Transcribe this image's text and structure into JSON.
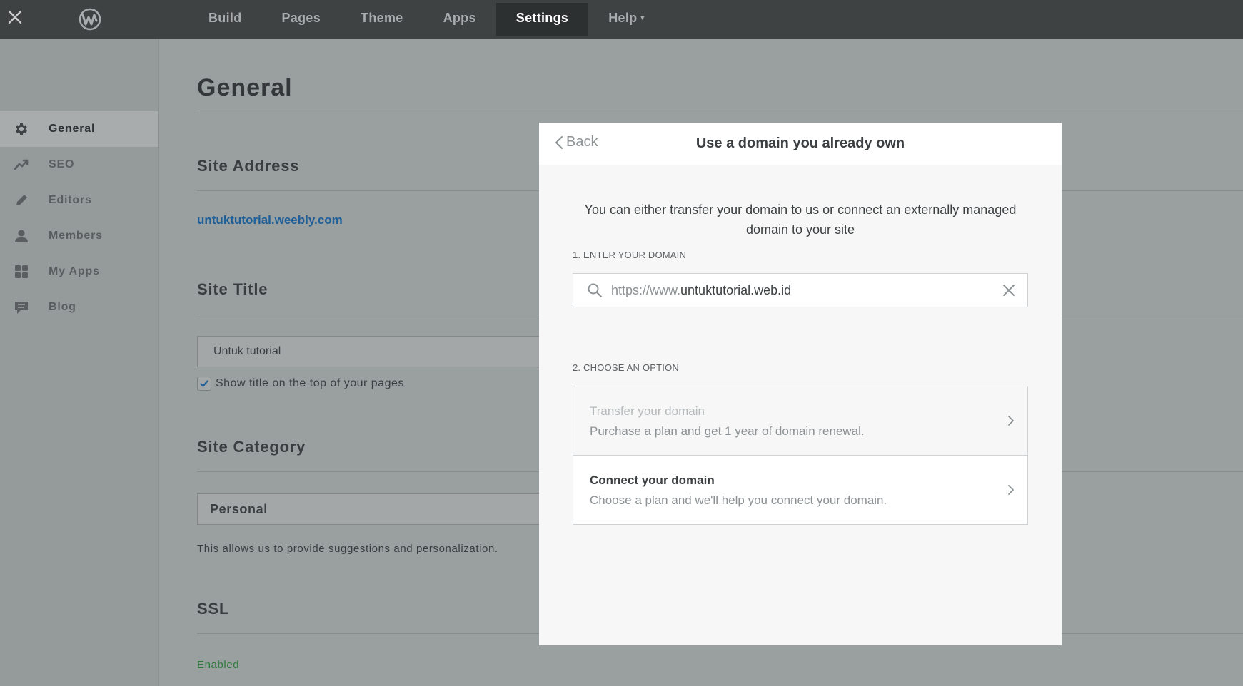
{
  "topbar": {
    "close_icon": "x-icon",
    "logo": "weebly-logo",
    "nav": [
      {
        "label": "Build"
      },
      {
        "label": "Pages"
      },
      {
        "label": "Theme"
      },
      {
        "label": "Apps"
      },
      {
        "label": "Settings"
      },
      {
        "label": "Help"
      }
    ],
    "active_nav": "Settings"
  },
  "sidebar": {
    "items": [
      {
        "label": "General",
        "icon": "gear-icon"
      },
      {
        "label": "SEO",
        "icon": "trend-icon"
      },
      {
        "label": "Editors",
        "icon": "pencil-icon"
      },
      {
        "label": "Members",
        "icon": "person-icon"
      },
      {
        "label": "My Apps",
        "icon": "grid-icon"
      },
      {
        "label": "Blog",
        "icon": "comment-icon"
      }
    ],
    "active": "General"
  },
  "main": {
    "title": "General",
    "site_address": {
      "heading": "Site Address",
      "url": "untuktutorial.weebly.com"
    },
    "site_title": {
      "heading": "Site Title",
      "value": "Untuk tutorial",
      "checkbox_label": "Show title on the top of your pages",
      "checked": true
    },
    "site_category": {
      "heading": "Site Category",
      "value": "Personal",
      "helper": "This allows us to provide suggestions and personalization."
    },
    "ssl": {
      "heading": "SSL",
      "status": "Enabled"
    }
  },
  "modal": {
    "back_label": "Back",
    "title": "Use a domain you already own",
    "intro": "You can either transfer your domain to us or connect an externally managed domain to your site",
    "step1_label": "1. ENTER YOUR DOMAIN",
    "domain_prefix": "https://www.",
    "domain_value": "untuktutorial.web.id",
    "step2_label": "2. CHOOSE AN OPTION",
    "options": [
      {
        "title": "Transfer your domain",
        "desc": "Purchase a plan and get 1 year of domain renewal.",
        "disabled": true
      },
      {
        "title": "Connect your domain",
        "desc": "Choose a plan and we'll help you connect your domain.",
        "disabled": false
      }
    ]
  },
  "colors": {
    "topbar": "#3f4243",
    "overlay_bg": "#9a9fa0",
    "link": "#1f5f98",
    "ssl_enabled": "#2d7a3a",
    "modal_bg": "#f7f7f7"
  }
}
